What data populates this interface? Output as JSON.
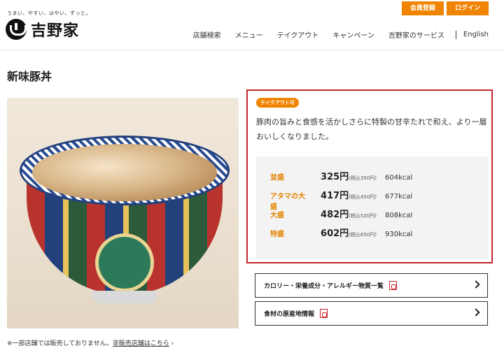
{
  "header": {
    "tagline": "うまい、やすい、はやい、ずっと。",
    "logo_text": "吉野家",
    "top_buttons": [
      "会員登録",
      "ログイン"
    ],
    "nav": [
      "店舗検索",
      "メニュー",
      "テイクアウト",
      "キャンペーン",
      "吉野家のサービス"
    ],
    "language": "English"
  },
  "page_title": "新味豚丼",
  "photo": {
    "icon": "gyudon-bowl-photo"
  },
  "note": {
    "text": "※一部店舗では販売しておりません。",
    "link": "非販売店舗はこちら",
    "arrow": "›"
  },
  "info": {
    "badge": "テイクアウト可",
    "description": "豚肉の旨みと食感を活かしさらに特製の甘辛たれで和え、より一層おいしくなりました。",
    "prices": [
      {
        "size": "並盛",
        "price": "325円",
        "tax": "(税込350円)",
        "kcal": "604kcal"
      },
      {
        "size": "アタマの大盛",
        "price": "417円",
        "tax": "(税込450円)",
        "kcal": "677kcal"
      },
      {
        "size": "大盛",
        "price": "482円",
        "tax": "(税込520円)",
        "kcal": "808kcal"
      },
      {
        "size": "特盛",
        "price": "602円",
        "tax": "(税込650円)",
        "kcal": "930kcal"
      }
    ]
  },
  "links": [
    {
      "label": "カロリー・栄養成分・アレルギー物質一覧"
    },
    {
      "label": "食材の原産地情報"
    }
  ],
  "colors": {
    "accent": "#f08300",
    "highlight_border": "#c9252c",
    "price_bg": "#f3f3f3"
  }
}
